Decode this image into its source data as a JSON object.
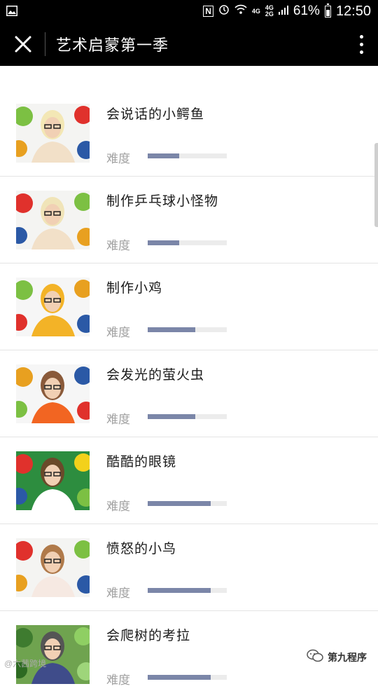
{
  "status_bar": {
    "nfc": "N",
    "net_top": "4G",
    "net_mid": "4G",
    "net_bot": "2G",
    "battery": "61%",
    "time": "12:50"
  },
  "title_bar": {
    "close_icon": "close-icon",
    "title": "艺术启蒙第一季",
    "more_icon": "more-vert-icon"
  },
  "list": {
    "difficulty_label": "难度",
    "items": [
      {
        "title": "会说话的小鳄鱼",
        "difficulty": 0.4
      },
      {
        "title": "制作乒乓球小怪物",
        "difficulty": 0.4
      },
      {
        "title": "制作小鸡",
        "difficulty": 0.6
      },
      {
        "title": "会发光的萤火虫",
        "difficulty": 0.6
      },
      {
        "title": "酷酷的眼镜",
        "difficulty": 0.8
      },
      {
        "title": "愤怒的小鸟",
        "difficulty": 0.8
      },
      {
        "title": "会爬树的考拉",
        "difficulty": 0.8
      }
    ]
  },
  "watermarks": {
    "left": "@六茜跨境",
    "right": "第九程序"
  },
  "colors": {
    "bar_fill": "#7b86a8",
    "bar_track": "#ececec",
    "header_bg": "#000000"
  }
}
